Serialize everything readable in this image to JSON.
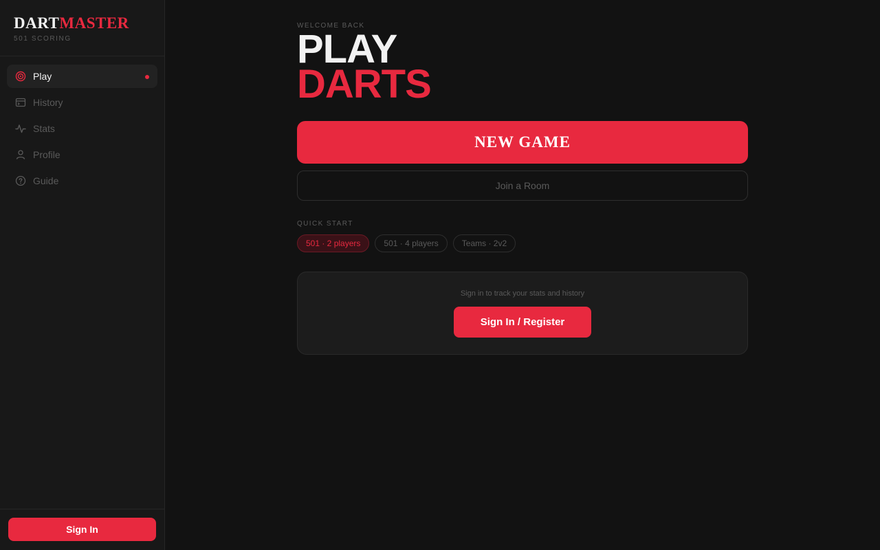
{
  "brand": {
    "name_part1": "DART",
    "name_part2": "MASTER",
    "subtitle": "501 SCORING"
  },
  "colors": {
    "accent": "#e8293f",
    "background": "#121212",
    "sidebar": "#181818",
    "muted_text": "#5a5a5a"
  },
  "sidebar": {
    "items": [
      {
        "label": "Play",
        "icon": "target-icon",
        "active": true
      },
      {
        "label": "History",
        "icon": "history-icon",
        "active": false
      },
      {
        "label": "Stats",
        "icon": "activity-icon",
        "active": false
      },
      {
        "label": "Profile",
        "icon": "user-icon",
        "active": false
      },
      {
        "label": "Guide",
        "icon": "help-circle-icon",
        "active": false
      }
    ],
    "signin_label": "Sign In"
  },
  "main": {
    "eyebrow": "WELCOME BACK",
    "hero_line1": "PLAY",
    "hero_line2": "DARTS",
    "new_game_label": "NEW GAME",
    "join_room_label": "Join a Room",
    "quick_start": {
      "label": "QUICK START",
      "chips": [
        "501 · 2 players",
        "501 · 4 players",
        "Teams · 2v2"
      ],
      "selected": "501 · 2 players"
    },
    "signin_card": {
      "text": "Sign in to track your stats and history",
      "button_label": "Sign In / Register"
    }
  }
}
